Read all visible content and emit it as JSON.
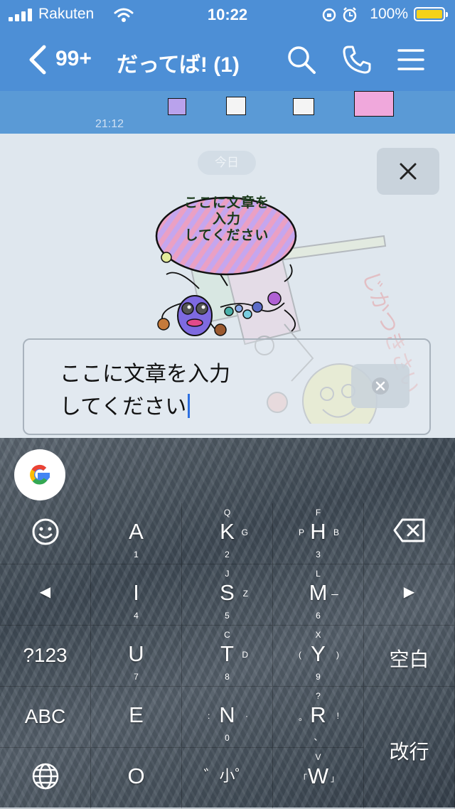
{
  "status_bar": {
    "carrier": "Rakuten",
    "time": "10:22",
    "battery": "100%"
  },
  "nav": {
    "unread_count": "99+",
    "title": "だってば! (1)"
  },
  "chat": {
    "message_time": "21:12"
  },
  "overlay": {
    "date_label": "今日",
    "sticker_text": "ここに文章を\n入力\nしてください",
    "input_value": "ここに文章を入力\nしてください"
  },
  "keyboard": {
    "rows": [
      [
        {
          "main": "",
          "icon": "emoji-icon"
        },
        {
          "main": "A",
          "down": "1"
        },
        {
          "main": "K",
          "up": "Q",
          "right": "G",
          "down": "2"
        },
        {
          "main": "H",
          "up": "F",
          "left": "P",
          "right": "B",
          "down": "3"
        },
        {
          "main": "",
          "icon": "backspace-icon"
        }
      ],
      [
        {
          "main": "◀"
        },
        {
          "main": "I",
          "down": "4"
        },
        {
          "main": "S",
          "up": "J",
          "right": "Z",
          "down": "5"
        },
        {
          "main": "M",
          "up": "L",
          "right": "ー",
          "down": "6"
        },
        {
          "main": "▶"
        }
      ],
      [
        {
          "main": "?123"
        },
        {
          "main": "U",
          "down": "7"
        },
        {
          "main": "T",
          "up": "C",
          "right": "D",
          "down": "8"
        },
        {
          "main": "Y",
          "up": "X",
          "left": "(",
          "right": ")",
          "down": "9"
        },
        {
          "main": "空白"
        }
      ],
      [
        {
          "main": "ABC"
        },
        {
          "main": "E"
        },
        {
          "main": "N",
          "left": ":",
          "right": "·",
          "down": "0"
        },
        {
          "main": "R",
          "up": "?",
          "left": "。",
          "right": "!",
          "down": "、"
        },
        {
          "main": "改行"
        }
      ],
      [
        {
          "main": "",
          "icon": "globe-icon"
        },
        {
          "main": "O"
        },
        {
          "main": "゛小゜"
        },
        {
          "main": "W",
          "up": "V",
          "left": "「",
          "right": "」"
        }
      ]
    ]
  },
  "colors": {
    "header_blue": "#4d8fd6",
    "caret_blue": "#2d6fe0",
    "overlay_bg": "#dfe7ee"
  }
}
